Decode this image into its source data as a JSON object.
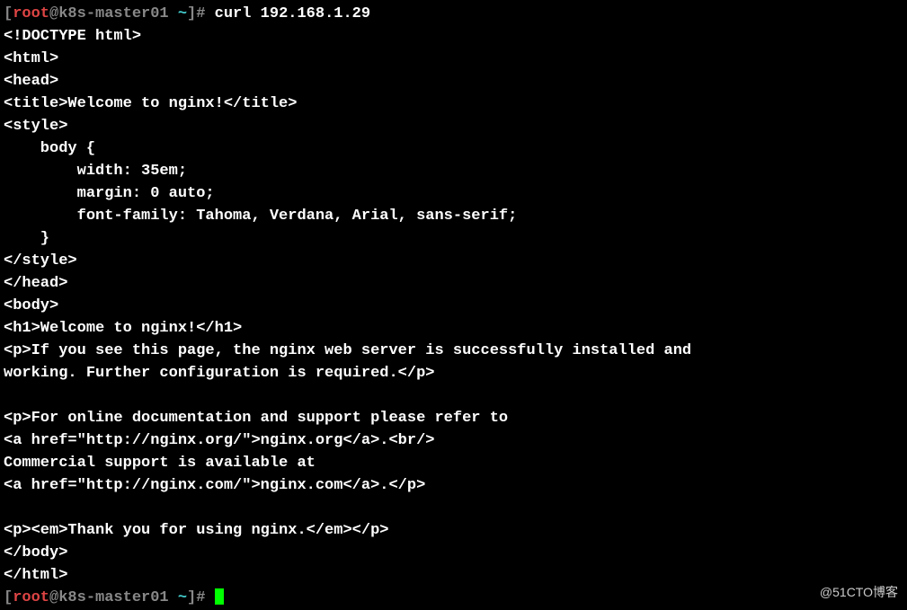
{
  "prompt1": {
    "bracket_open": "[",
    "user": "root",
    "at_host": "@k8s-master01 ",
    "cwd": "~",
    "bracket_hash": "]# ",
    "command": "curl 192.168.1.29"
  },
  "output": {
    "l01": "<!DOCTYPE html>",
    "l02": "<html>",
    "l03": "<head>",
    "l04": "<title>Welcome to nginx!</title>",
    "l05": "<style>",
    "l06": "    body {",
    "l07": "        width: 35em;",
    "l08": "        margin: 0 auto;",
    "l09": "        font-family: Tahoma, Verdana, Arial, sans-serif;",
    "l10": "    }",
    "l11": "</style>",
    "l12": "</head>",
    "l13": "<body>",
    "l14": "<h1>Welcome to nginx!</h1>",
    "l15": "<p>If you see this page, the nginx web server is successfully installed and",
    "l16": "working. Further configuration is required.</p>",
    "blank1": "",
    "l17": "<p>For online documentation and support please refer to",
    "l18": "<a href=\"http://nginx.org/\">nginx.org</a>.<br/>",
    "l19": "Commercial support is available at",
    "l20": "<a href=\"http://nginx.com/\">nginx.com</a>.</p>",
    "blank2": "",
    "l21": "<p><em>Thank you for using nginx.</em></p>",
    "l22": "</body>",
    "l23": "</html>"
  },
  "prompt2": {
    "bracket_open": "[",
    "user": "root",
    "at_host": "@k8s-master01 ",
    "cwd": "~",
    "bracket_hash": "]# "
  },
  "watermark": "@51CTO博客"
}
